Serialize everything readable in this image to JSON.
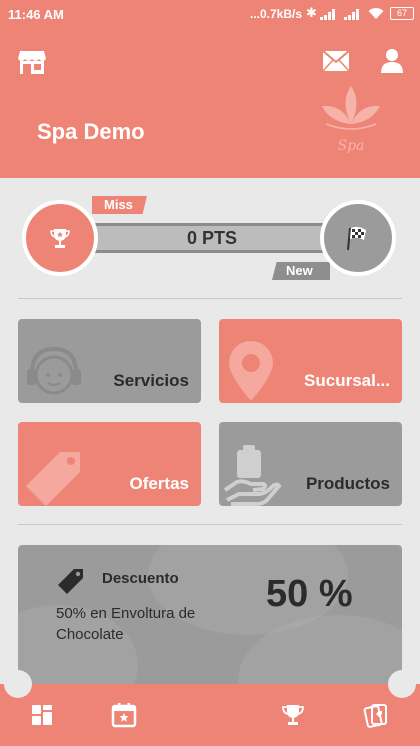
{
  "status_bar": {
    "time": "11:46 AM",
    "network_speed": "...0.7kB/s",
    "battery": "67"
  },
  "header": {
    "brand_name": "Spa Demo",
    "logo_text": "Spa",
    "accent_color": "#ee8476"
  },
  "points": {
    "current_rank": "Miss",
    "points_label": "0 PTS",
    "next_rank": "New"
  },
  "tiles": [
    {
      "label": "Servicios",
      "icon": "headset-icon",
      "color": "#9b9b9b"
    },
    {
      "label": "Sucursal...",
      "icon": "location-pin-icon",
      "color": "#ee8476"
    },
    {
      "label": "Ofertas",
      "icon": "price-tag-icon",
      "color": "#ee8476"
    },
    {
      "label": "Productos",
      "icon": "product-hand-icon",
      "color": "#9b9b9b"
    }
  ],
  "promo": {
    "title": "Descuento",
    "description": "50% en Envoltura de Chocolate",
    "value": "50 %"
  },
  "bottom_nav": [
    {
      "icon": "dashboard-icon"
    },
    {
      "icon": "calendar-star-icon"
    },
    {
      "icon": "trophy-icon"
    },
    {
      "icon": "coupons-icon"
    }
  ]
}
